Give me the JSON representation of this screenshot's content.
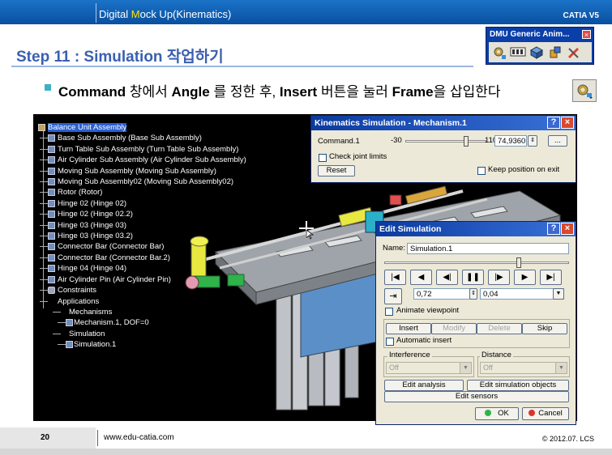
{
  "header": {
    "title_prefix": "Digital ",
    "title_mark": "M",
    "title_rest": "ock Up(Kinematics)",
    "brand": "CATIA V5"
  },
  "step": {
    "title": "Step 11 : Simulation 작업하기"
  },
  "dmu_toolbar": {
    "title": "DMU Generic Anim...",
    "close": "×",
    "icons": [
      "simulation-gear-icon",
      "player-icon",
      "cube-icon",
      "clash-icon",
      "tools-icon"
    ]
  },
  "instruction": {
    "w1": "Command",
    "t1": " 창에서 ",
    "w2": "Angle",
    "t2": " 를 정한 후, ",
    "w3": "Insert",
    "t3": " 버튼을 눌러 ",
    "w4": "Frame",
    "t4": "을 삽입한다"
  },
  "tree": {
    "root": "Balance Unit Assembly",
    "items": [
      "Base Sub Assembly (Base Sub Assembly)",
      "Turn Table Sub Assembly (Turn Table Sub Assembly)",
      "Air Cylinder Sub Assembly (Air Cylinder Sub Assembly)",
      "Moving Sub Assembly (Moving Sub Assembly)",
      "Moving Sub Assembly02 (Moving Sub Assembly02)",
      "Rotor (Rotor)",
      "Hinge 02 (Hinge 02)",
      "Hinge 02 (Hinge 02.2)",
      "Hinge 03 (Hinge 03)",
      "Hinge 03 (Hinge 03.2)",
      "Connector Bar (Connector Bar)",
      "Connector Bar (Connector Bar.2)",
      "Hinge 04 (Hinge 04)",
      "Air Cylinder Pin (Air Cylinder Pin)",
      "Constraints"
    ],
    "applications": "Applications",
    "mechanisms": "Mechanisms",
    "mechanism": "Mechanism.1, DOF=0",
    "simulation": "Simulation",
    "simulation_item": "Simulation.1"
  },
  "kinematics": {
    "title": "Kinematics Simulation - Mechanism.1",
    "help": "?",
    "close": "×",
    "command_label": "Command.1",
    "min": "-30",
    "max": "110",
    "value": "74,9360",
    "slider_fraction": 0.75,
    "dots": "...",
    "check_joint": "Check joint limits",
    "reset": "Reset",
    "keep_position": "Keep position on exit"
  },
  "edit_sim": {
    "title": "Edit Simulation",
    "help": "?",
    "close": "×",
    "name_label": "Name:",
    "name_value": "Simulation.1",
    "slider_fraction": 0.73,
    "player": [
      "|◀",
      "◀",
      "◀|",
      "❚❚",
      "|▶",
      "▶",
      "▶|"
    ],
    "step_value": "0,72",
    "step_size": "0,04",
    "animate_viewpoint": "Animate viewpoint",
    "insert": "Insert",
    "modify": "Modify",
    "delete": "Delete",
    "skip": "Skip",
    "automatic_insert": "Automatic insert",
    "interference_label": "Interference",
    "interference_value": "Off",
    "distance_label": "Distance",
    "distance_value": "Off",
    "edit_analysis": "Edit analysis",
    "edit_sim_objects": "Edit simulation objects",
    "edit_sensors": "Edit sensors",
    "ok": "OK",
    "cancel": "Cancel"
  },
  "footer": {
    "page": "20",
    "url": "www.edu-catia.com",
    "copyright": "© 2012.07. LCS"
  },
  "colors": {
    "header_blue": "#0a4fa0",
    "heading_blue": "#3a5fb0",
    "title_bar": "#0a3aa0",
    "dialog_bg": "#ece9d8",
    "tree_select": "#2a5fd0"
  }
}
